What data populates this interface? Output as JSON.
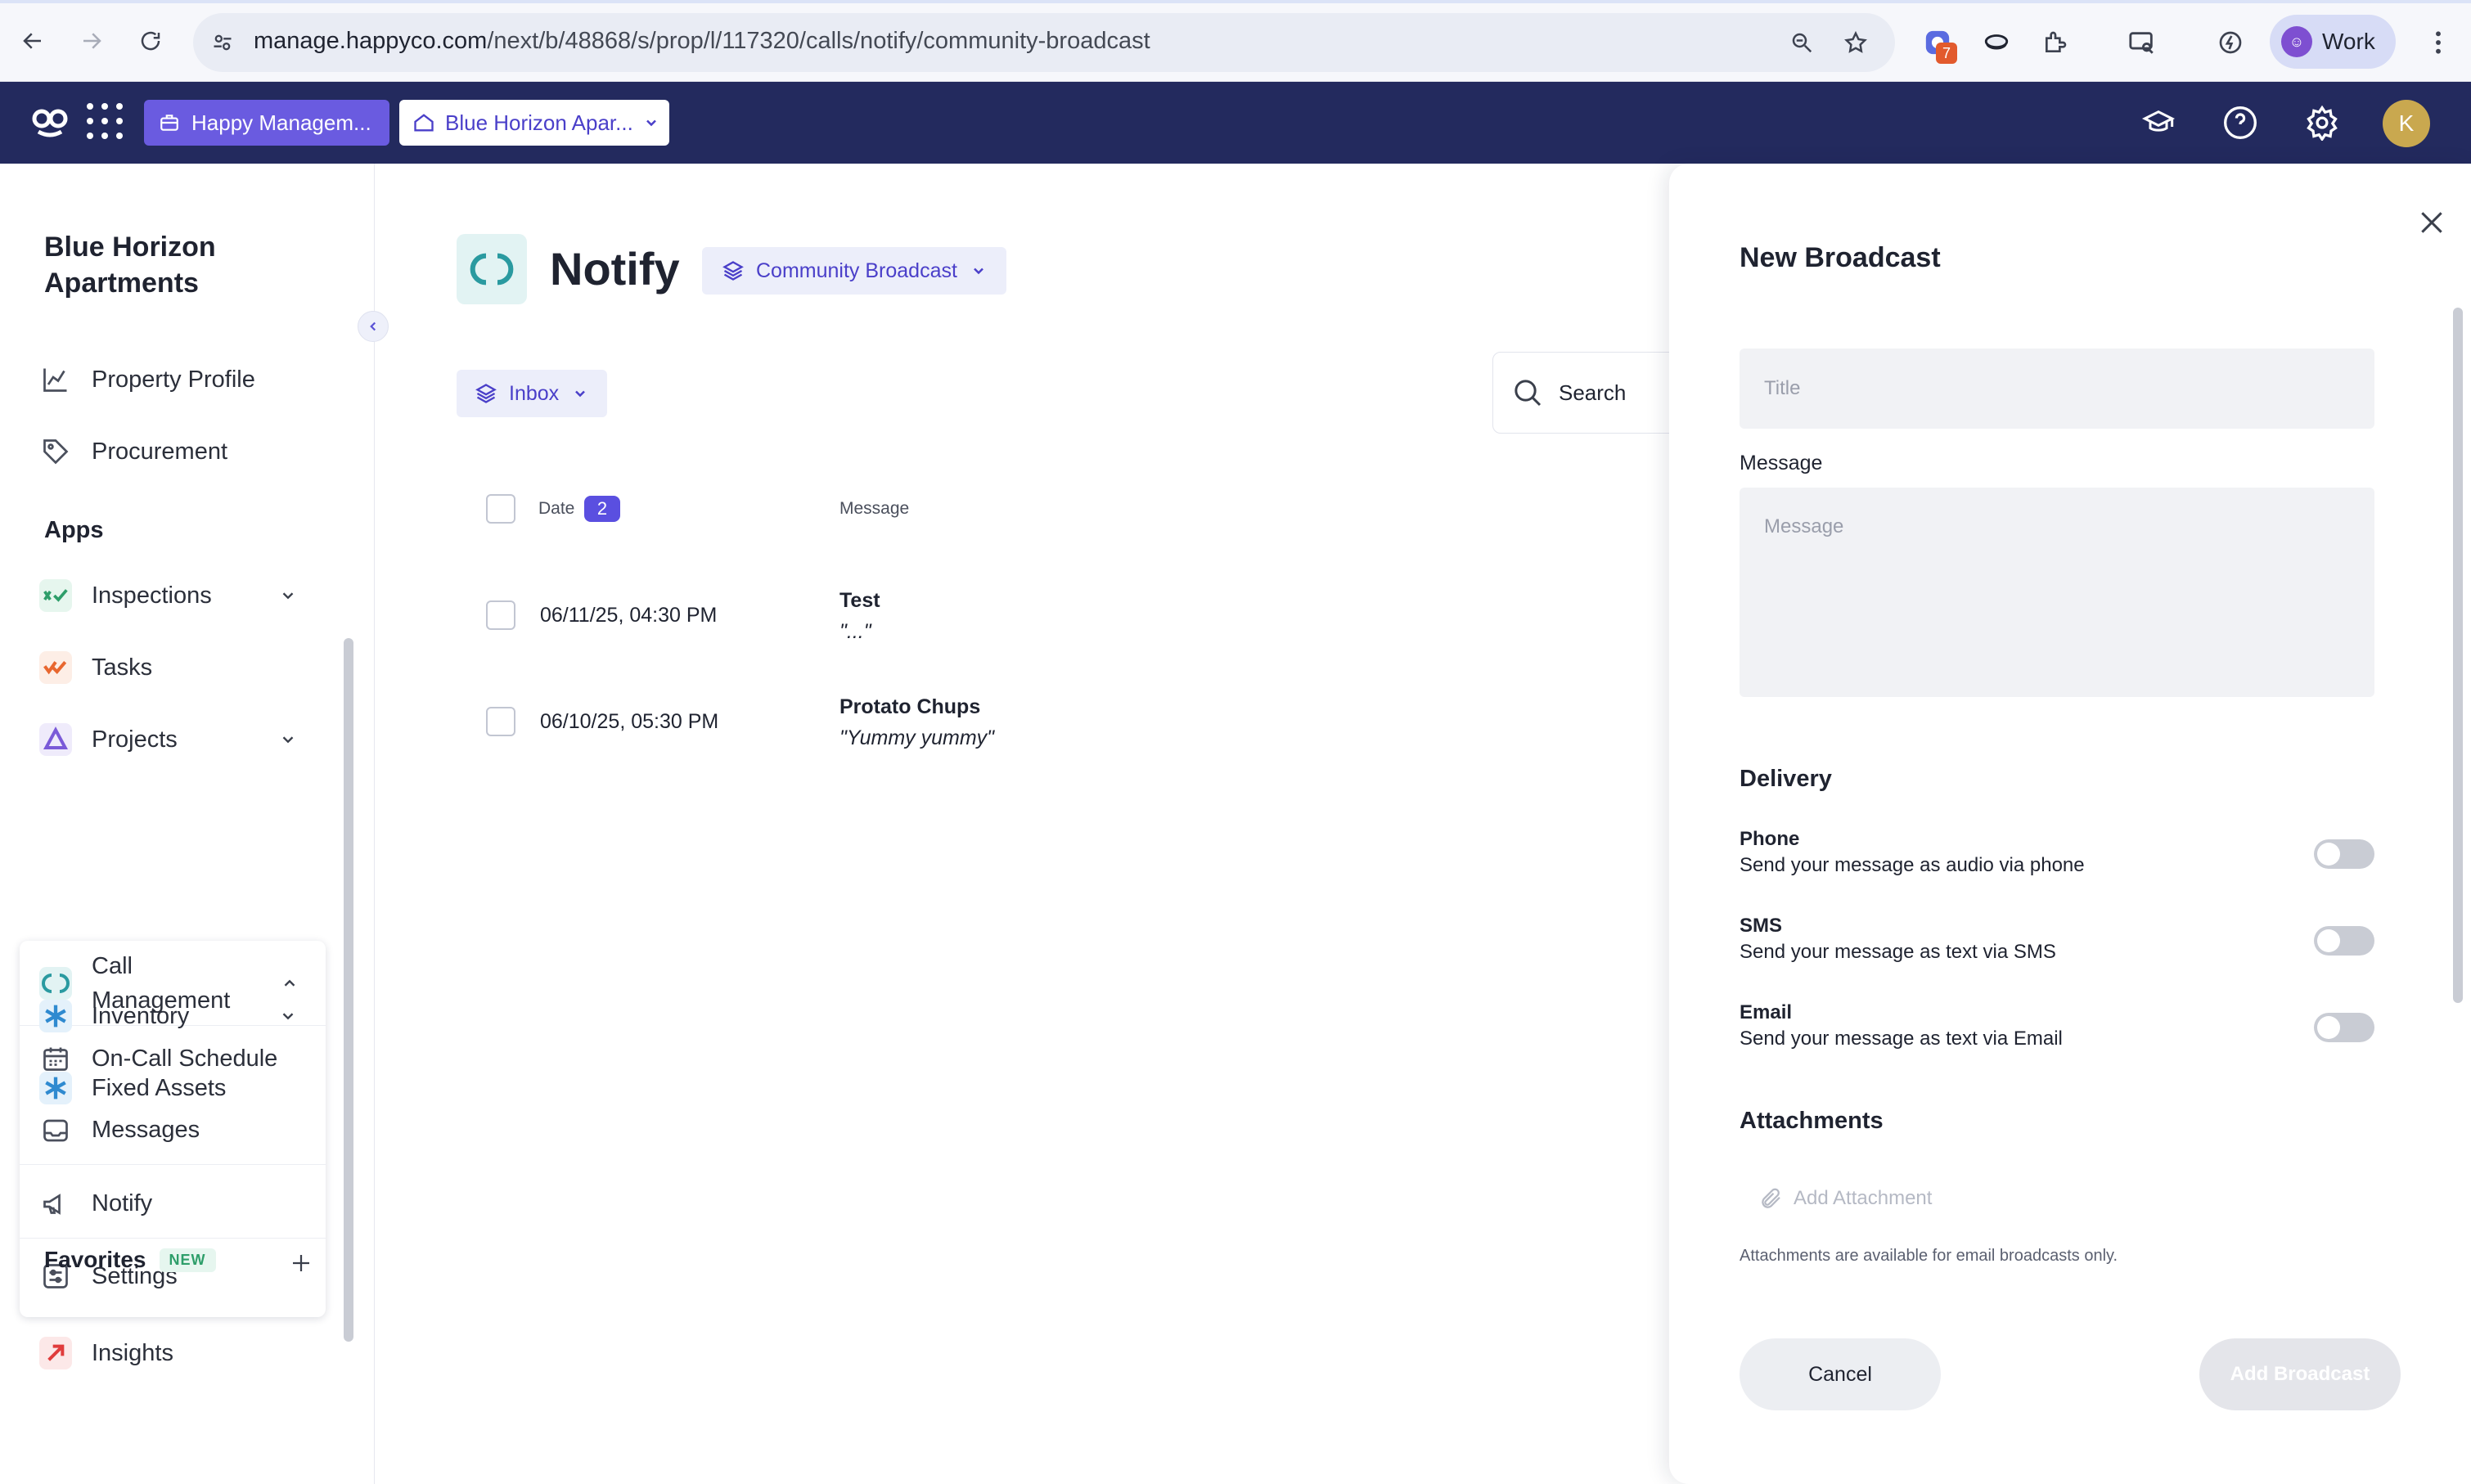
{
  "browser": {
    "url_host": "manage.happyco.com",
    "url_path": "/next/b/48868/s/prop/l/117320/calls/notify/community-broadcast",
    "extension_badge": "7",
    "profile_label": "Work"
  },
  "appbar": {
    "org_label": "Happy Managem...",
    "property_label": "Blue Horizon Apar...",
    "user_initial": "K"
  },
  "sidebar": {
    "property_title": "Blue Horizon Apartments",
    "items_top": [
      {
        "label": "Property Profile"
      },
      {
        "label": "Procurement"
      }
    ],
    "apps_heading": "Apps",
    "apps": [
      {
        "label": "Inspections"
      },
      {
        "label": "Tasks"
      },
      {
        "label": "Projects"
      }
    ],
    "call_management": {
      "label": "Call Management",
      "children": [
        {
          "label": "On-Call Schedule"
        },
        {
          "label": "Messages"
        },
        {
          "label": "Notify"
        },
        {
          "label": "Settings"
        }
      ]
    },
    "apps_bottom": [
      {
        "label": "Insights"
      },
      {
        "label": "Inventory"
      },
      {
        "label": "Fixed Assets"
      }
    ],
    "favorites_label": "Favorites",
    "favorites_badge": "NEW"
  },
  "main": {
    "page_title": "Notify",
    "broadcast_select": "Community Broadcast",
    "inbox_label": "Inbox",
    "search_placeholder": "Search",
    "table": {
      "col_date": "Date",
      "date_count": "2",
      "col_message": "Message",
      "rows": [
        {
          "date": "06/11/25, 04:30 PM",
          "title": "Test",
          "message": "\"...\""
        },
        {
          "date": "06/10/25, 05:30 PM",
          "title": "Protato Chups",
          "message": "\"Yummy yummy\""
        }
      ]
    }
  },
  "panel": {
    "title": "New Broadcast",
    "title_placeholder": "Title",
    "message_label": "Message",
    "message_placeholder": "Message",
    "delivery_label": "Delivery",
    "options": [
      {
        "title": "Phone",
        "desc": "Send your message as audio via phone",
        "enabled": false
      },
      {
        "title": "SMS",
        "desc": "Send your message as text via SMS",
        "enabled": false
      },
      {
        "title": "Email",
        "desc": "Send your message as text via Email",
        "enabled": false
      }
    ],
    "attachments_label": "Attachments",
    "add_attachment": "Add Attachment",
    "attachment_note": "Attachments are available for email broadcasts only.",
    "cancel_label": "Cancel",
    "add_label": "Add Broadcast"
  },
  "colors": {
    "appbar": "#232a5e",
    "accent": "#5a4fe0",
    "org_chip": "#6a5be0"
  }
}
